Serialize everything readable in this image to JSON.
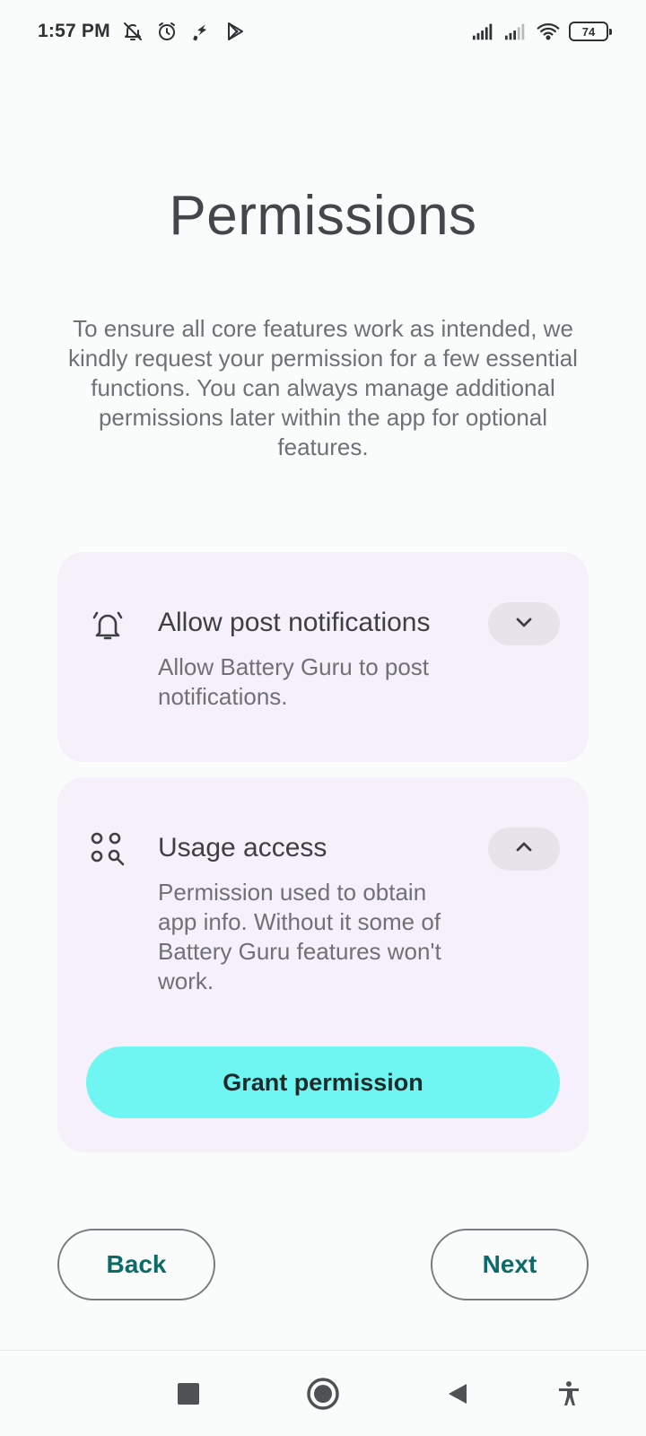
{
  "status_bar": {
    "time": "1:57 PM",
    "left_icons": [
      "bell-off-icon",
      "alarm-icon",
      "charging-plug-icon",
      "play-store-icon"
    ],
    "right_icons": [
      "cell-signal-1-icon",
      "cell-signal-2-icon",
      "wifi-icon"
    ],
    "battery_level": "74"
  },
  "page": {
    "title": "Permissions",
    "description": "To ensure all core features work as intended, we kindly request your permission for a few essential functions. You can always manage additional permissions later within the app for optional features."
  },
  "permissions": [
    {
      "icon": "bell-ringing-icon",
      "title": "Allow post notifications",
      "description": "Allow Battery Guru to post notifications.",
      "expanded": false
    },
    {
      "icon": "apps-search-icon",
      "title": "Usage access",
      "description": "Permission used to obtain app info. Without it some of Battery Guru features won't work.",
      "expanded": true,
      "action_label": "Grant permission"
    }
  ],
  "footer": {
    "back_label": "Back",
    "next_label": "Next"
  },
  "nav_bar": {
    "items": [
      "recents-square-icon",
      "home-circle-icon",
      "back-triangle-icon",
      "accessibility-icon"
    ]
  },
  "colors": {
    "background": "#fafbfb",
    "card": "#f5f0f9",
    "accent": "#6ff6f2",
    "button_text": "#0b6b68"
  }
}
